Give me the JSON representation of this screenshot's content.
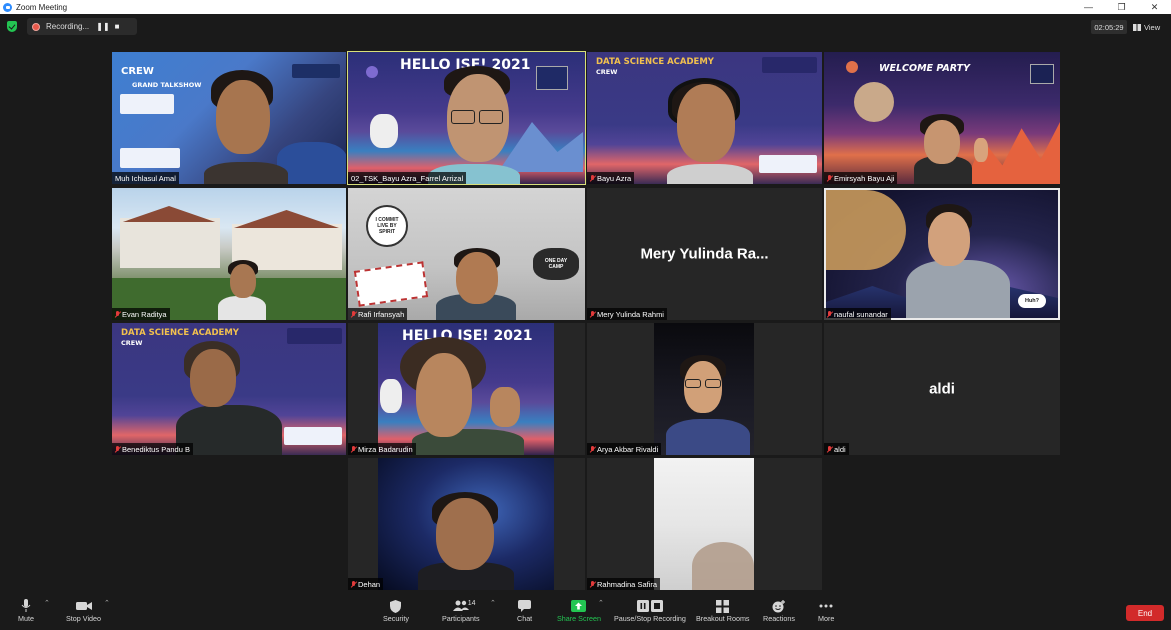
{
  "window": {
    "title": "Zoom Meeting",
    "controls": [
      "—",
      "❐",
      "✕"
    ]
  },
  "topbar": {
    "recording_label": "Recording...",
    "pause_glyph": "❚❚",
    "stop_glyph": "■",
    "elapsed": "02:05:29",
    "view_label": "View"
  },
  "tiles": [
    {
      "name": "Muh Ichlasul Amal",
      "muted": false,
      "banner": "CREW",
      "banner2": "GRAND TALKSHOW"
    },
    {
      "name": "02_TSK_Bayu Azra_Farrel Arrizal",
      "muted": false,
      "banner": "HELLO ISE! 2021"
    },
    {
      "name": "Bayu Azra",
      "muted": true,
      "banner": "DATA SCIENCE ACADEMY",
      "banner2": "CREW"
    },
    {
      "name": "Emirsyah Bayu Aji",
      "muted": true,
      "banner": "WELCOME PARTY"
    },
    {
      "name": "Evan Raditya",
      "muted": true
    },
    {
      "name": "Rafi Irfansyah",
      "muted": true,
      "sticker": "I COMMIT LIVE BY SPIRIT",
      "sticker2": "ONE DAY CAMP"
    },
    {
      "name": "Mery Yulinda Rahmi",
      "muted": true,
      "display_name": "Mery Yulinda Ra..."
    },
    {
      "name": "naufal sunandar",
      "muted": true,
      "speech": "Huh?"
    },
    {
      "name": "Benediktus Pandu B",
      "muted": true,
      "banner": "DATA SCIENCE ACADEMY",
      "banner2": "CREW"
    },
    {
      "name": "Mirza Badarudin",
      "muted": true,
      "banner": "HELLO ISE! 2021"
    },
    {
      "name": "Arya Akbar Rivaldi",
      "muted": true
    },
    {
      "name": "aldi",
      "muted": true,
      "display_name": "aldi"
    },
    {
      "name": "Dehan",
      "muted": true
    },
    {
      "name": "Rahmadina Safira",
      "muted": true
    }
  ],
  "toolbar": {
    "mute": "Mute",
    "stop_video": "Stop Video",
    "security": "Security",
    "participants": "Participants",
    "participants_count": "14",
    "chat": "Chat",
    "share_screen": "Share Screen",
    "recording": "Pause/Stop Recording",
    "breakout": "Breakout Rooms",
    "reactions": "Reactions",
    "more": "More",
    "end": "End"
  },
  "colors": {
    "share_green": "#23c552",
    "end_red": "#d22a2a",
    "active_speaker": "#d8e07a",
    "mute_red": "#e23b3b"
  }
}
